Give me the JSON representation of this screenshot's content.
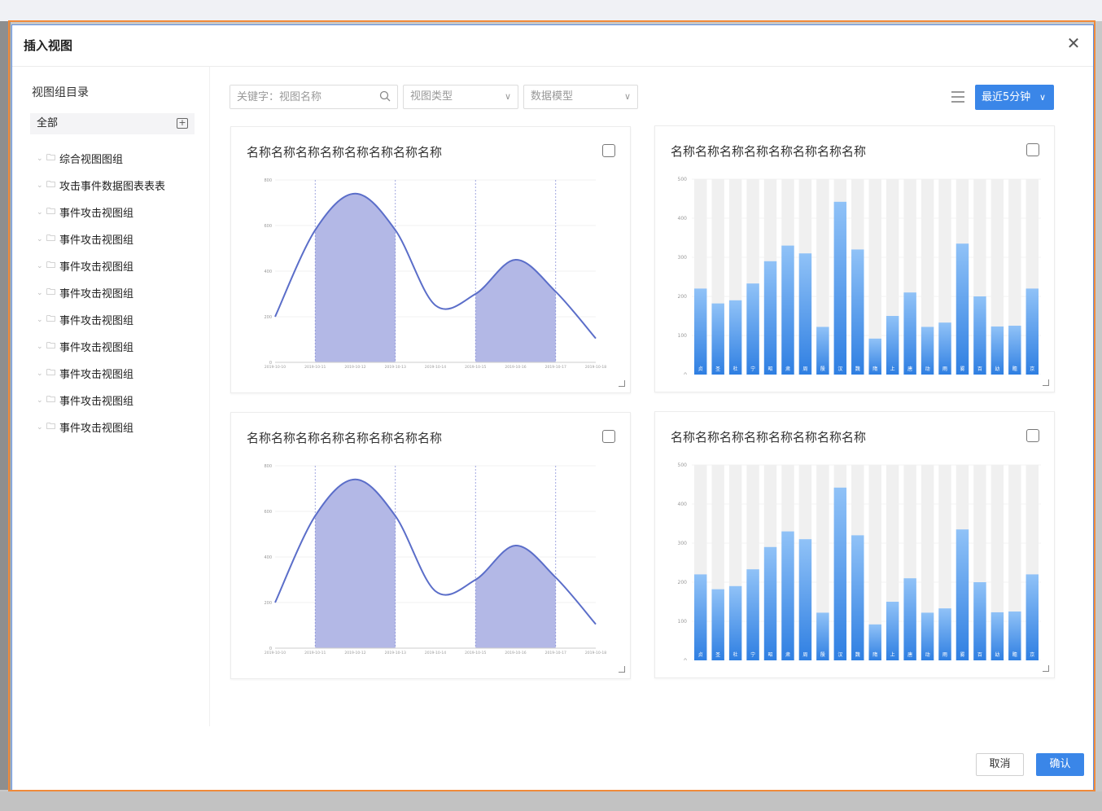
{
  "dialog": {
    "title": "插入视图",
    "close_icon": "close-icon"
  },
  "sidebar": {
    "title": "视图组目录",
    "all_label": "全部",
    "add_icon": "folder-add-icon",
    "items": [
      {
        "label": "综合视图图组"
      },
      {
        "label": "攻击事件数据图表表表"
      },
      {
        "label": "事件攻击视图组"
      },
      {
        "label": "事件攻击视图组"
      },
      {
        "label": "事件攻击视图组"
      },
      {
        "label": "事件攻击视图组"
      },
      {
        "label": "事件攻击视图组"
      },
      {
        "label": "事件攻击视图组"
      },
      {
        "label": "事件攻击视图组"
      },
      {
        "label": "事件攻击视图组"
      },
      {
        "label": "事件攻击视图组"
      }
    ]
  },
  "toolbar": {
    "search_placeholder": "关键字：视图名称",
    "view_type_placeholder": "视图类型",
    "data_model_placeholder": "数据模型",
    "time_range": "最近5分钟"
  },
  "footer": {
    "cancel": "取消",
    "confirm": "确认"
  },
  "colors": {
    "accent": "#3a86e8",
    "line": "#5b6ec9",
    "area": "#b3b8e6",
    "bar_top": "#90c2f7",
    "bar_bottom": "#2f7fe2",
    "bar_bg": "#f0f0f0"
  },
  "cards": [
    {
      "title": "名称名称名称名称名称名称名称名称"
    },
    {
      "title": "名称名称名称名称名称名称名称名称"
    },
    {
      "title": "名称名称名称名称名称名称名称名称"
    },
    {
      "title": "名称名称名称名称名称名称名称名称"
    }
  ],
  "chart_data": [
    {
      "type": "area",
      "x": [
        "2019-10-10",
        "2019-10-11",
        "2019-10-12",
        "2019-10-13",
        "2019-10-14",
        "2019-10-15",
        "2019-10-16",
        "2019-10-17",
        "2019-10-18"
      ],
      "y": [
        200,
        580,
        740,
        580,
        250,
        300,
        450,
        310,
        105
      ],
      "shaded_ranges": [
        [
          "2019-10-11",
          "2019-10-13"
        ],
        [
          "2019-10-15",
          "2019-10-17"
        ]
      ],
      "ylim": [
        0,
        800
      ],
      "yticks": [
        0,
        200,
        400,
        600,
        800
      ]
    },
    {
      "type": "bar",
      "categories": [
        "贞",
        "圣",
        "杜",
        "宁",
        "昭",
        "肃",
        "周",
        "殷",
        "汉",
        "魏",
        "隋",
        "上",
        "唐",
        "动",
        "雨",
        "雾",
        "百",
        "幼",
        "瞻",
        "京"
      ],
      "values": [
        220,
        182,
        190,
        233,
        290,
        330,
        310,
        122,
        442,
        320,
        92,
        150,
        210,
        122,
        133,
        335,
        200,
        123,
        125,
        220
      ],
      "ylim": [
        0,
        500
      ],
      "yticks": [
        0,
        100,
        200,
        300,
        400,
        500
      ]
    },
    {
      "type": "area",
      "x": [
        "2019-10-10",
        "2019-10-11",
        "2019-10-12",
        "2019-10-13",
        "2019-10-14",
        "2019-10-15",
        "2019-10-16",
        "2019-10-17",
        "2019-10-18"
      ],
      "y": [
        200,
        580,
        740,
        580,
        250,
        300,
        450,
        310,
        105
      ],
      "shaded_ranges": [
        [
          "2019-10-11",
          "2019-10-13"
        ],
        [
          "2019-10-15",
          "2019-10-17"
        ]
      ],
      "ylim": [
        0,
        800
      ],
      "yticks": [
        0,
        200,
        400,
        600,
        800
      ]
    },
    {
      "type": "bar",
      "categories": [
        "贞",
        "圣",
        "杜",
        "宁",
        "昭",
        "肃",
        "周",
        "殷",
        "汉",
        "魏",
        "隋",
        "上",
        "唐",
        "动",
        "雨",
        "雾",
        "百",
        "幼",
        "瞻",
        "京"
      ],
      "values": [
        220,
        182,
        190,
        233,
        290,
        330,
        310,
        122,
        442,
        320,
        92,
        150,
        210,
        122,
        133,
        335,
        200,
        123,
        125,
        220
      ],
      "ylim": [
        0,
        500
      ],
      "yticks": [
        0,
        100,
        200,
        300,
        400,
        500
      ]
    }
  ]
}
